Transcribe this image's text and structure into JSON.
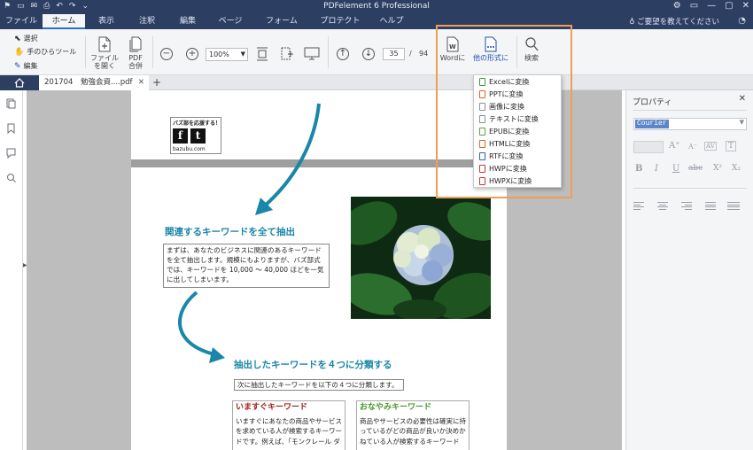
{
  "app": {
    "title": "PDFelement 6 Professional",
    "quick_access": [
      "⚑",
      "▭",
      "✉",
      "⎙",
      "↶",
      "↷",
      "⌄"
    ],
    "window_controls": [
      "⚙",
      "▭",
      "—",
      "▢",
      "✕"
    ]
  },
  "menu": {
    "tabs": [
      "ファイル",
      "ホーム",
      "表示",
      "注釈",
      "編集",
      "ページ",
      "フォーム",
      "プロテクト",
      "ヘルプ"
    ],
    "active": "ホーム",
    "help_search": "ご要望を教えてください",
    "user_icon": "◔"
  },
  "ribbon": {
    "modes": [
      "選択",
      "手のひらツール",
      "編集"
    ],
    "open_file": [
      "ファイル",
      "を開く"
    ],
    "pdf_merge": [
      "PDF",
      "合併"
    ],
    "zoom_value": "100%",
    "page_current": "35",
    "page_separator": "/",
    "page_total": "94",
    "to_word": "Wordに",
    "to_other": "他の形式に",
    "search": "検索"
  },
  "convert_menu": {
    "items": [
      {
        "label": "Excelに変換",
        "color": "#3a9a4a"
      },
      {
        "label": "PPTに変換",
        "color": "#d8662f"
      },
      {
        "label": "画像に変換",
        "color": "#7a7f88"
      },
      {
        "label": "テキストに変換",
        "color": "#7a7f88"
      },
      {
        "label": "EPUBに変換",
        "color": "#5aa046"
      },
      {
        "label": "HTMLに変換",
        "color": "#d8662f"
      },
      {
        "label": "RTFに変換",
        "color": "#2f5fb0"
      },
      {
        "label": "HWPに変換",
        "color": "#c03a3a"
      },
      {
        "label": "HWPXに変換",
        "color": "#c03a3a"
      }
    ]
  },
  "document_tab": {
    "label": "201704　勉強会資....pdf",
    "close": "✕",
    "add": "+"
  },
  "document": {
    "share": {
      "title": "バズ部を応援する！",
      "icons": [
        "f",
        "t"
      ],
      "url": "bazubu.com"
    },
    "heading1": "関連するキーワードを全て抽出",
    "para1": "まずは、あなたのビジネスに関連のあるキーワードを全て抽出します。規模にもよりますが、バズ部式では、キーワードを 10,000 ～ 40,000 ほどを一気に出してしまいます。",
    "heading2": "抽出したキーワードを４つに分類する",
    "para2": "次に抽出したキーワードを以下の４つに分類します。",
    "col1": {
      "title": "いますぐキーワード",
      "title_color": "#a02020",
      "text": "いますぐにあなたの商品やサービスを求めている人が検索するキーワードです。例えば、「モンクレール ダ"
    },
    "col2": {
      "title": "おなやみキーワード",
      "title_color": "#4a9a30",
      "text": "商品やサービスの必要性は確実に持っているがどの商品が良いか決めかねている人が検索するキーワード"
    }
  },
  "properties": {
    "title": "プロパティ",
    "close": "✕",
    "font": "Courier",
    "format_buttons": [
      "A⁺",
      "A⁻",
      "AV",
      "T",
      "B",
      "I",
      "U",
      "abc",
      "X²",
      "X₂"
    ]
  },
  "colors": {
    "titlebar": "#2d3e63",
    "accent_blue": "#1f4fa8",
    "heading_teal": "#1a86a8",
    "highlight_orange": "#f29d55"
  }
}
